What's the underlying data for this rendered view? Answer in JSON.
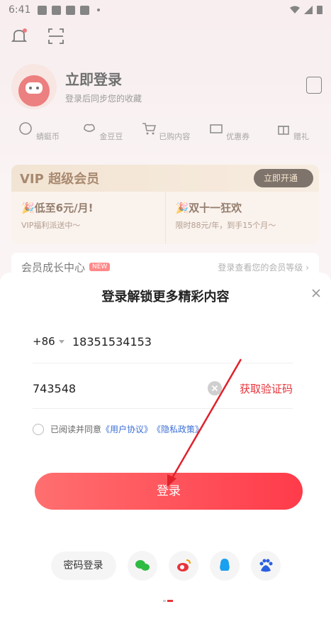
{
  "status_bar": {
    "time": "6:41"
  },
  "profile": {
    "title": "立即登录",
    "subtitle": "登录后同步您的收藏"
  },
  "quick_items": [
    {
      "label": "蜻蜓币",
      "icon": "coin-icon"
    },
    {
      "label": "金豆豆",
      "icon": "bean-icon"
    },
    {
      "label": "已购内容",
      "icon": "cart-icon"
    },
    {
      "label": "优惠券",
      "icon": "coupon-icon"
    },
    {
      "label": "赠礼",
      "icon": "gift-icon"
    }
  ],
  "vip": {
    "title": "VIP 超级会员",
    "button": "立即开通",
    "cells": [
      {
        "headline": "🎉低至6元/月!",
        "sub": "VIP福利派送中～"
      },
      {
        "headline": "🎉双十一狂欢",
        "sub": "限时88元/年，到手15个月～"
      }
    ]
  },
  "growth": {
    "title": "会员成长中心",
    "tag": "NEW",
    "right": "登录查看您的会员等级 ›"
  },
  "sheet": {
    "title": "登录解锁更多精彩内容",
    "country_code": "+86",
    "phone": "18351534153",
    "code": "743548",
    "get_code": "获取验证码",
    "agree_prefix": "已阅读并同意",
    "user_agreement": "《用户协议》",
    "privacy_policy": "《隐私政策》",
    "login_button": "登录",
    "password_login": "密码登录"
  },
  "colors": {
    "accent": "#e8333a",
    "login_gradient_start": "#ff6f6f",
    "login_gradient_end": "#ff3b4a",
    "link": "#3b6fd6"
  }
}
